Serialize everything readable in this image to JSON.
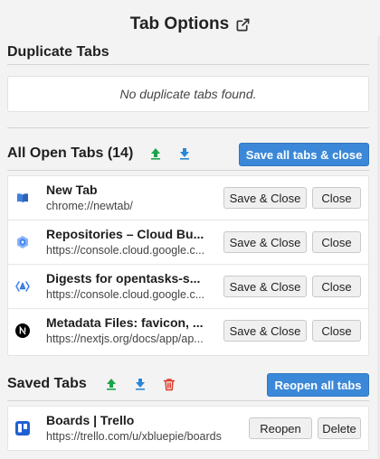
{
  "header": {
    "title": "Tab Options",
    "icon": "external-link-icon"
  },
  "duplicate": {
    "title": "Duplicate Tabs",
    "empty_text": "No duplicate tabs found."
  },
  "open_tabs": {
    "title": "All Open Tabs (14)",
    "export_icon": "upload-arrow-icon",
    "import_icon": "download-arrow-icon",
    "save_all_label": "Save all tabs & close",
    "save_close_label": "Save & Close",
    "close_label": "Close",
    "items": [
      {
        "title": "New Tab",
        "url": "chrome://newtab/",
        "icon": "book-icon"
      },
      {
        "title": "Repositories – Cloud Bu...",
        "url": "https://console.cloud.google.c...",
        "icon": "cloud-build-icon"
      },
      {
        "title": "Digests for opentasks-s...",
        "url": "https://console.cloud.google.c...",
        "icon": "cloud-code-icon"
      },
      {
        "title": "Metadata Files: favicon, ...",
        "url": "https://nextjs.org/docs/app/ap...",
        "icon": "nextjs-icon"
      }
    ]
  },
  "saved_tabs": {
    "title": "Saved Tabs",
    "export_icon": "upload-arrow-icon",
    "import_icon": "download-arrow-icon",
    "delete_icon": "trash-icon",
    "reopen_all_label": "Reopen all tabs",
    "reopen_label": "Reopen",
    "delete_label": "Delete",
    "items": [
      {
        "title": "Boards | Trello",
        "url": "https://trello.com/u/xbluepie/boards",
        "icon": "trello-icon"
      }
    ]
  },
  "colors": {
    "primary": "#3b88d8",
    "export_green": "#1aa34a",
    "import_blue": "#2a86d6",
    "delete_red": "#d93a2b"
  }
}
